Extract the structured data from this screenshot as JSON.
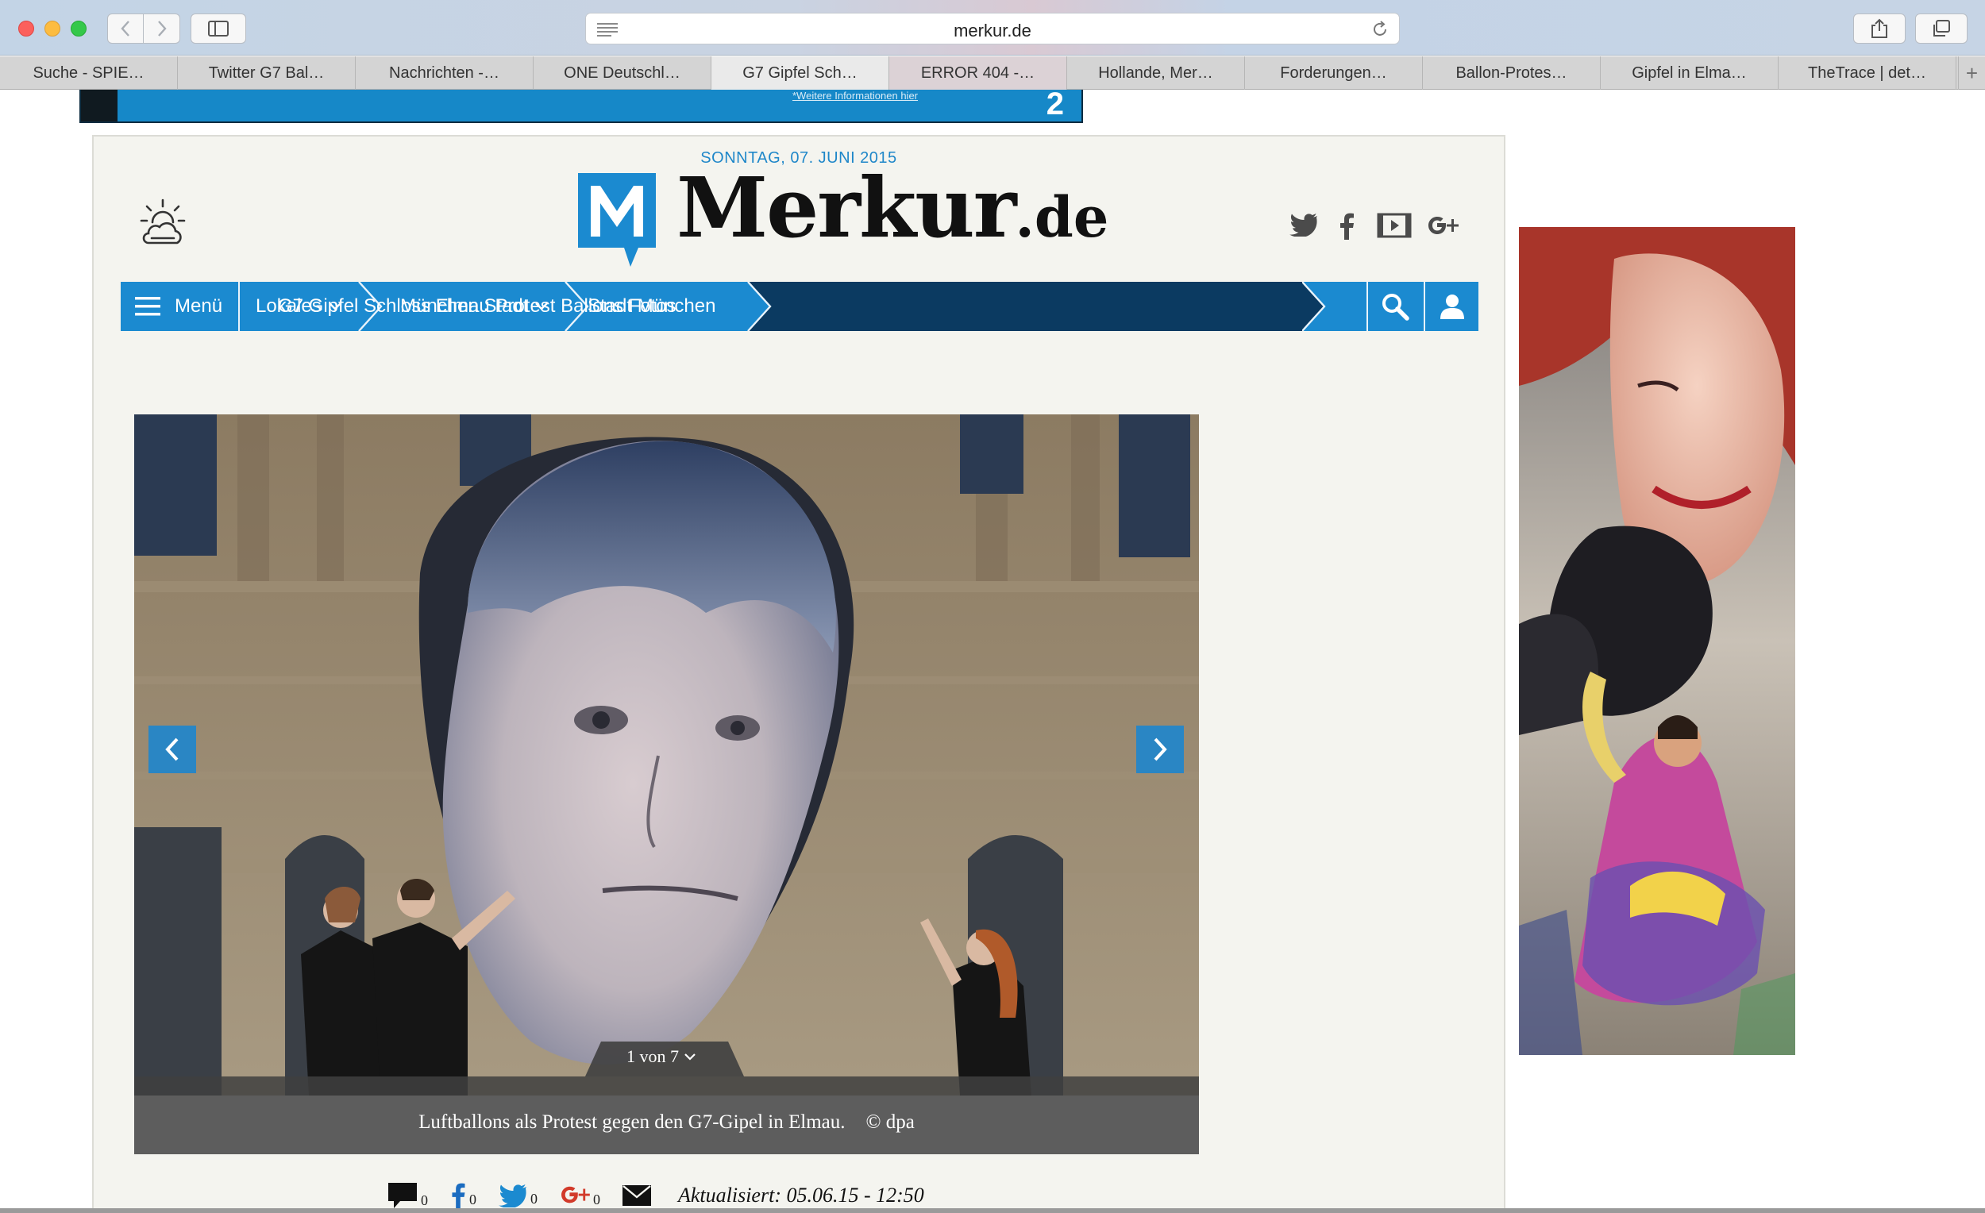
{
  "browser": {
    "url": "merkur.de",
    "tabs": [
      {
        "label": "Suche - SPIE…"
      },
      {
        "label": "Twitter G7 Bal…"
      },
      {
        "label": "Nachrichten -…"
      },
      {
        "label": "ONE Deutschl…"
      },
      {
        "label": "G7 Gipfel Sch…"
      },
      {
        "label": "ERROR 404 -…"
      },
      {
        "label": "Hollande, Mer…"
      },
      {
        "label": "Forderungen…"
      },
      {
        "label": "Ballon-Protes…"
      },
      {
        "label": "Gipfel in Elma…"
      },
      {
        "label": "TheTrace | det…"
      }
    ],
    "new_tab_glyph": "+"
  },
  "top_ad": {
    "link_text": "*Weitere Informationen hier",
    "number": "2"
  },
  "header": {
    "date": "SONNTAG, 07. JUNI 2015",
    "logo_name": "Merkur",
    "logo_tld": ".de",
    "weather_icon": "weather-sun-cloud-icon"
  },
  "nav": {
    "menu_label": "Menü",
    "lokales_label": "Lokales",
    "muenchen_stadt_label": "München Stadt",
    "stadt_muenchen_label": "Stadt München",
    "current_label": "G7 Gipfel Schloss Elmau Protest Ballons Fotos"
  },
  "gallery": {
    "counter": "1 von 7",
    "caption": "Luftballons als Protest gegen den G7-Gipel in Elmau.",
    "credit": "© dpa"
  },
  "meta": {
    "comments_count": "0",
    "facebook_count": "0",
    "twitter_count": "0",
    "gplus_count": "0",
    "updated": "Aktualisiert: 05.06.15 - 12:50"
  },
  "colors": {
    "brand_blue": "#1b8ad0",
    "nav_dark": "#0b3a61",
    "page_bg": "#f4f4ef"
  }
}
